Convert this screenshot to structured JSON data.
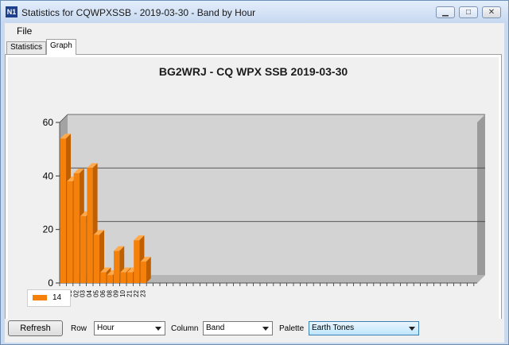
{
  "window": {
    "title": "Statistics for CQWPXSSB - 2019-03-30 - Band by Hour",
    "icon": "n1mm-logo-icon",
    "controls": [
      "minimize-icon",
      "maximize-icon",
      "close-icon"
    ]
  },
  "menu": {
    "file": "File"
  },
  "tabs": [
    {
      "label": "Statistics",
      "active": false
    },
    {
      "label": "Graph",
      "active": true
    }
  ],
  "chart_data": {
    "type": "bar",
    "title": "BG2WRJ - CQ WPX SSB 2019-03-30",
    "categories": [
      "00",
      "01",
      "02",
      "03",
      "04",
      "05",
      "06",
      "08",
      "09",
      "10",
      "21",
      "22",
      "23"
    ],
    "series": [
      {
        "name": "14",
        "color": "#f5800a",
        "values": [
          54,
          38,
          41,
          25,
          43,
          18,
          4,
          3,
          12,
          4,
          4,
          16,
          8
        ]
      }
    ],
    "ylim": [
      0,
      60
    ],
    "yticks": [
      "0",
      "20",
      "40",
      "60"
    ],
    "grid": true,
    "legend_position": "bottom-left",
    "style": "3d"
  },
  "toolbar": {
    "refresh": "Refresh",
    "row_label": "Row",
    "row_value": "Hour",
    "column_label": "Column",
    "column_value": "Band",
    "palette_label": "Palette",
    "palette_value": "Earth Tones"
  }
}
